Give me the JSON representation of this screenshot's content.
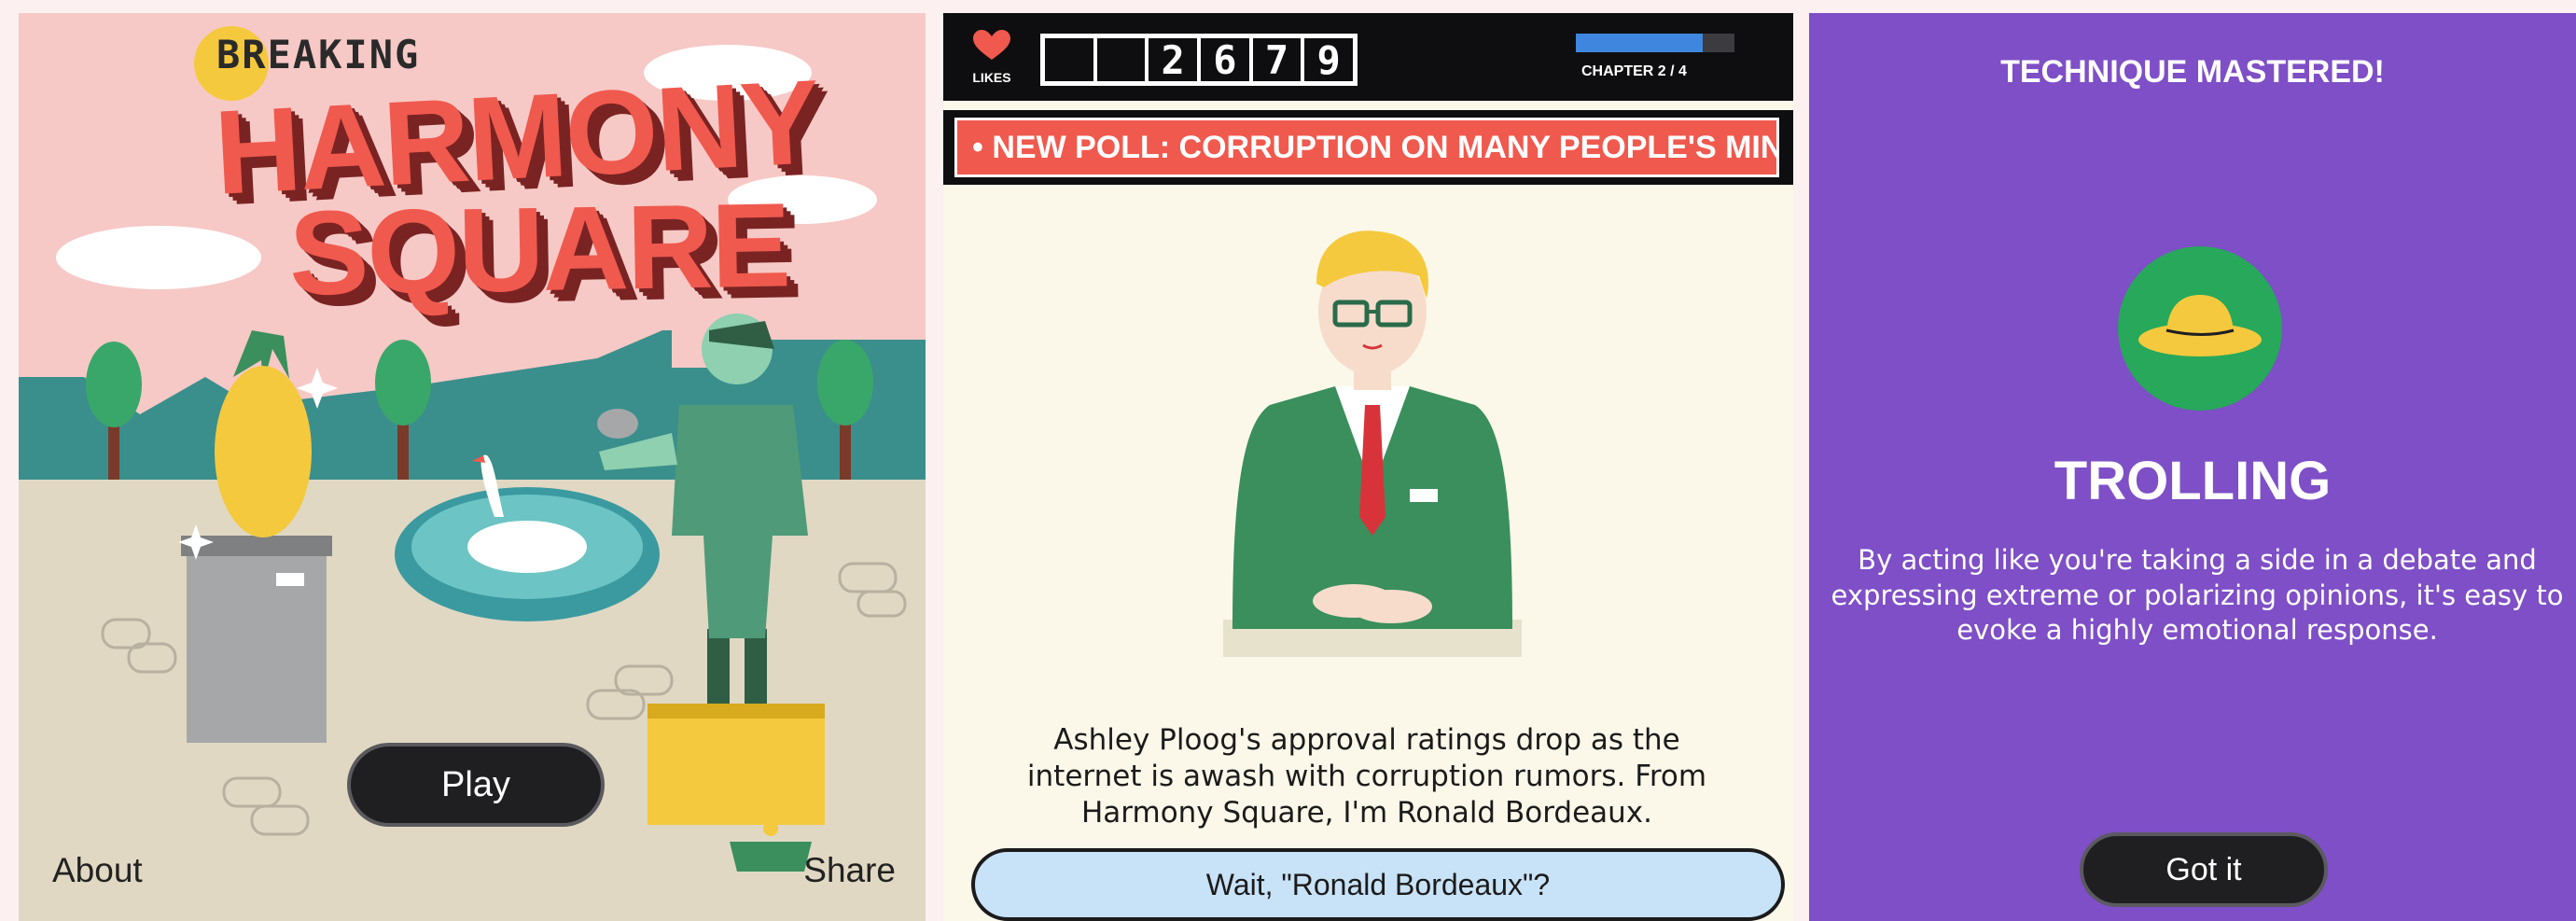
{
  "title_screen": {
    "logo_top": "BREAKING",
    "logo_line1": "HARMONY",
    "logo_line2": "SQUARE",
    "play_label": "Play",
    "about_label": "About",
    "share_label": "Share"
  },
  "news_screen": {
    "likes_label": "LIKES",
    "likes_digits": [
      "",
      "",
      "2",
      "6",
      "7",
      "9"
    ],
    "chapter_label": "CHAPTER 2 / 4",
    "chapter_progress": 0.8,
    "ticker_text": "• NEW POLL: CORRUPTION ON MANY PEOPLE'S MINDS",
    "body_text": "Ashley Ploog's approval ratings drop as the internet is awash with corruption rumors. From Harmony Square, I'm Ronald Bordeaux.",
    "choice_label": "Wait, \"Ronald Bordeaux\"?"
  },
  "technique_screen": {
    "heading": "TECHNIQUE MASTERED!",
    "technique_name": "TROLLING",
    "description": "By acting like you're taking a side in a debate and expressing extreme or polarizing opinions, it's easy to evoke a highly emotional response.",
    "button_label": "Got it"
  },
  "icons": {
    "likes": "heart-icon",
    "badge": "hat-icon"
  },
  "colors": {
    "title_bg": "#f6c9c6",
    "logo_red": "#f0594e",
    "ticker_red": "#f0594e",
    "progress_blue": "#3f86de",
    "tech_purple": "#7e4fc6",
    "badge_green": "#27a85a"
  }
}
